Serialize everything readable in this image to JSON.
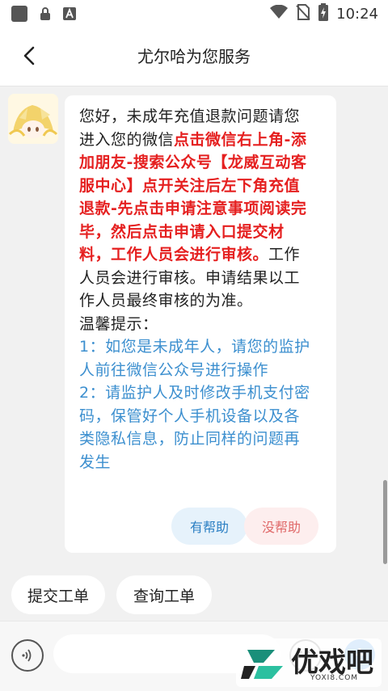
{
  "status_bar": {
    "time": "10:24",
    "icons": [
      "notification-square-icon",
      "lock-icon",
      "font-a-icon",
      "wifi-icon",
      "no-sim-icon",
      "battery-charging-icon"
    ]
  },
  "header": {
    "title": "尤尔哈为您服务",
    "back_icon": "chevron-left-icon"
  },
  "message": {
    "avatar": "anime-girl-avatar",
    "intro": "您好，未成年充值退款问题请您进入您的微信",
    "highlight": "点击微信右上角-添加朋友-搜索公众号【龙威互动客服中心】点开关注后左下角充值退款-先点击申请注意事项阅读完毕，然后点击申请入口提交材料，工作人员会进行审核。",
    "after": "工作人员会进行审核。申请结果以工作人员最终审核的为准。",
    "tip_title": "温馨提示：",
    "tip_1": "1：如您是未成年人，请您的监护人前往微信公众号进行操作",
    "tip_2": "2：请监护人及时修改手机支付密码，保管好个人手机设备以及各类隐私信息，防止同样的问题再发生",
    "helpful_label": "有帮助",
    "not_helpful_label": "没帮助"
  },
  "quick_actions": {
    "submit_ticket": "提交工单",
    "query_ticket": "查询工单"
  },
  "input_bar": {
    "placeholder": "",
    "voice_icon": "voice-wave-icon",
    "emoji_icon": "emoji-face-icon",
    "plus_icon": "plus-icon"
  },
  "watermark": {
    "brand": "优戏吧",
    "domain": "YOXI8.COM"
  },
  "colors": {
    "highlight_red": "#e52020",
    "tip_blue": "#3c8fcf",
    "accent_blue": "#2f8fe6"
  }
}
